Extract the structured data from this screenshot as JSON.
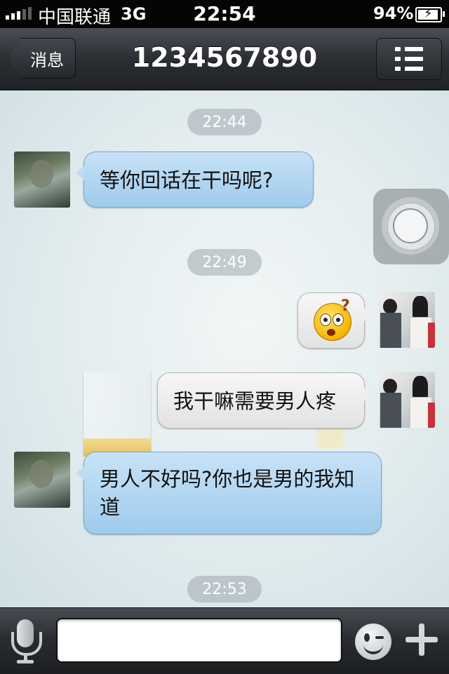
{
  "status_bar": {
    "carrier": "中国联通",
    "network": "3G",
    "time": "22:54",
    "battery_percent": "94%",
    "battery_level": 0.94,
    "signal_icon": "signal-bars-icon",
    "battery_icon": "battery-charging-icon"
  },
  "nav": {
    "back_label": "消息",
    "title": "1234567890",
    "menu_icon": "list-menu-icon"
  },
  "messages": [
    {
      "type": "timestamp",
      "text": "22:44"
    },
    {
      "type": "incoming",
      "text": "等你回话在干吗呢?"
    },
    {
      "type": "timestamp",
      "text": "22:49"
    },
    {
      "type": "outgoing-emoji",
      "emoji": "surprised-question-emoji-icon"
    },
    {
      "type": "outgoing",
      "text": "我干嘛需要男人疼"
    },
    {
      "type": "incoming",
      "text": "男人不好吗?你也是男的我知道"
    },
    {
      "type": "timestamp",
      "text": "22:53"
    }
  ],
  "input_bar": {
    "voice_icon": "microphone-icon",
    "input_value": "",
    "emoji_icon": "smiley-wink-icon",
    "add_icon": "plus-icon"
  },
  "colors": {
    "incoming_bubble": "#aed3f0",
    "outgoing_bubble": "#ebebeb",
    "nav_bar": "#2b2e33",
    "status_bar": "#050505"
  }
}
